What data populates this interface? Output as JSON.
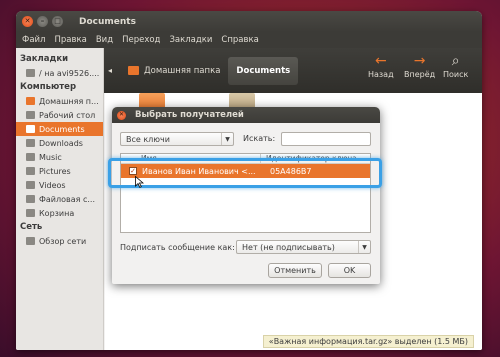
{
  "window": {
    "title": "Documents"
  },
  "menu": [
    "Файл",
    "Правка",
    "Вид",
    "Переход",
    "Закладки",
    "Справка"
  ],
  "path_bar": {
    "crumbs": [
      "Домашняя папка",
      "Documents"
    ]
  },
  "nav": {
    "back_label": "Назад",
    "forward_label": "Вперёд",
    "search_label": "Поиск"
  },
  "sidebar": {
    "bookmarks_title": "Закладки",
    "bookmarks": [
      "/ на avi9526...."
    ],
    "computer_title": "Компьютер",
    "computer": [
      "Домашняя п...",
      "Рабочий стол",
      "Documents",
      "Downloads",
      "Music",
      "Pictures",
      "Videos",
      "Файловая с...",
      "Корзина"
    ],
    "network_title": "Сеть",
    "network": [
      "Обзор сети"
    ]
  },
  "status": "«Важная информация.tar.gz» выделен (1.5 МБ)",
  "dialog": {
    "title": "Выбрать получателей",
    "filter_value": "Все ключи",
    "search_label": "Искать:",
    "search_value": "",
    "columns": [
      "Имя",
      "Идентификатор ключа"
    ],
    "rows": [
      {
        "name": "Иванов Иван Иванович <...",
        "key_id": "05A486B7",
        "checked": true
      }
    ],
    "sign_label": "Подписать сообщение как:",
    "sign_value": "Нет (не подписывать)",
    "cancel_label": "Отменить",
    "ok_label": "OK"
  }
}
